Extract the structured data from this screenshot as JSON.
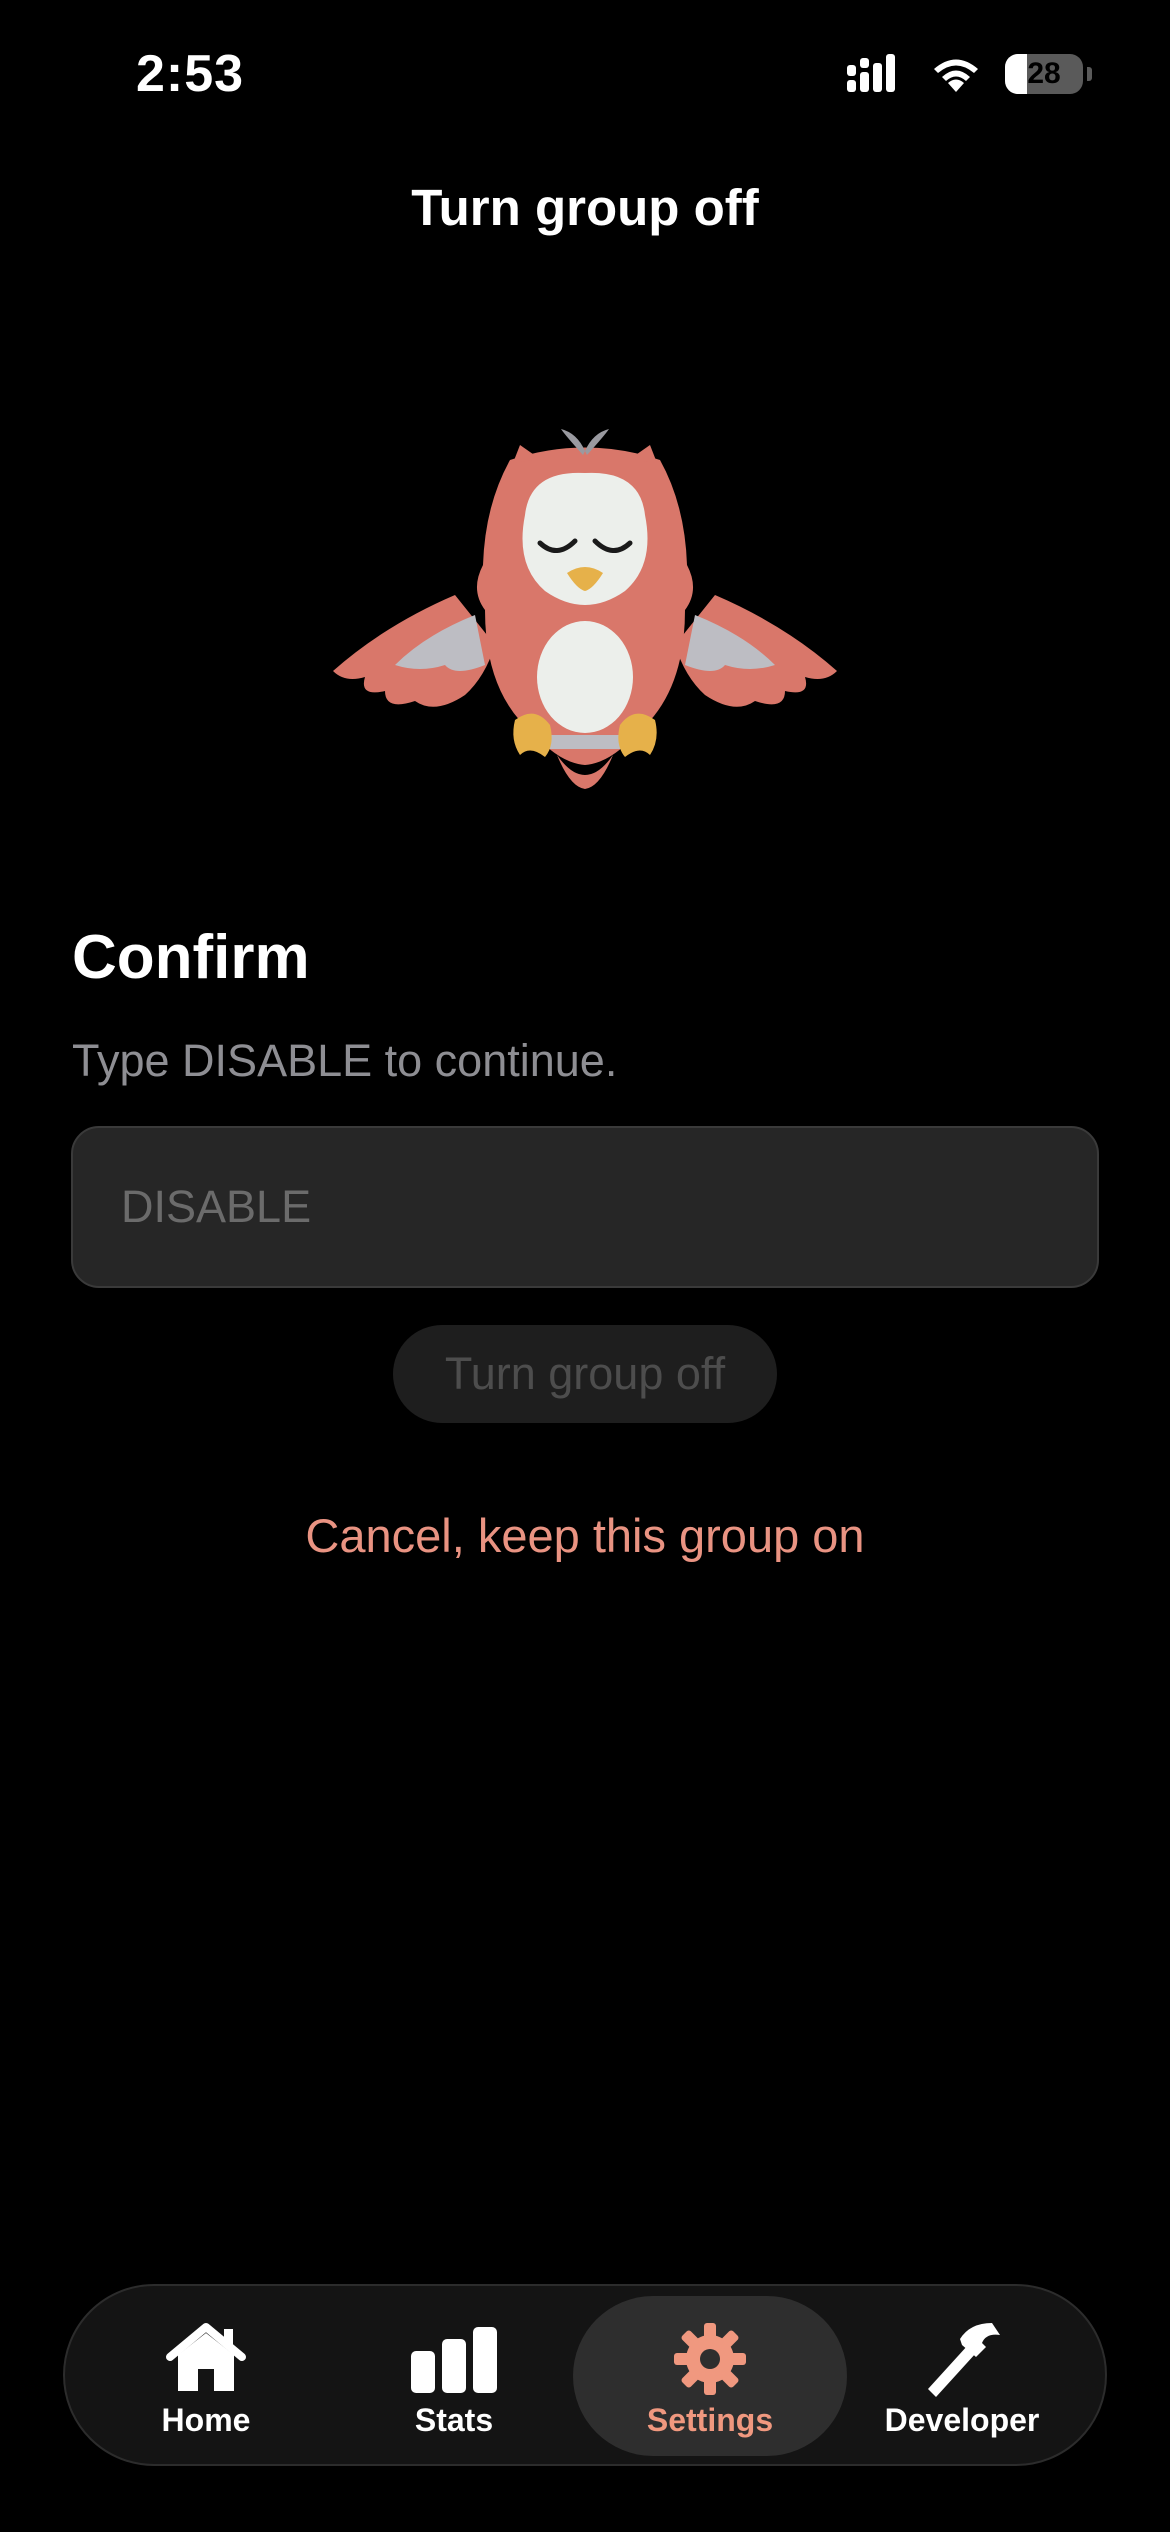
{
  "status_bar": {
    "time": "2:53",
    "battery_level": "28",
    "battery_fraction": 0.28
  },
  "header": {
    "title": "Turn group off"
  },
  "mascot": {
    "icon": "owl-mascot-icon",
    "colors": {
      "body": "#d9776a",
      "face": "#ecefeb",
      "wing": "#bdbdc3",
      "feet": "#e6b14a"
    }
  },
  "confirm": {
    "heading": "Confirm",
    "instruction": "Type DISABLE to continue.",
    "input_value": "",
    "input_placeholder": "DISABLE",
    "submit_label": "Turn group off",
    "cancel_label": "Cancel, keep this group on"
  },
  "tab_bar": {
    "active": "Settings",
    "accent_color": "#f0987f",
    "tabs": [
      {
        "label": "Home",
        "icon": "home-icon"
      },
      {
        "label": "Stats",
        "icon": "bar-chart-icon"
      },
      {
        "label": "Settings",
        "icon": "gear-icon"
      },
      {
        "label": "Developer",
        "icon": "hammer-icon"
      }
    ]
  }
}
